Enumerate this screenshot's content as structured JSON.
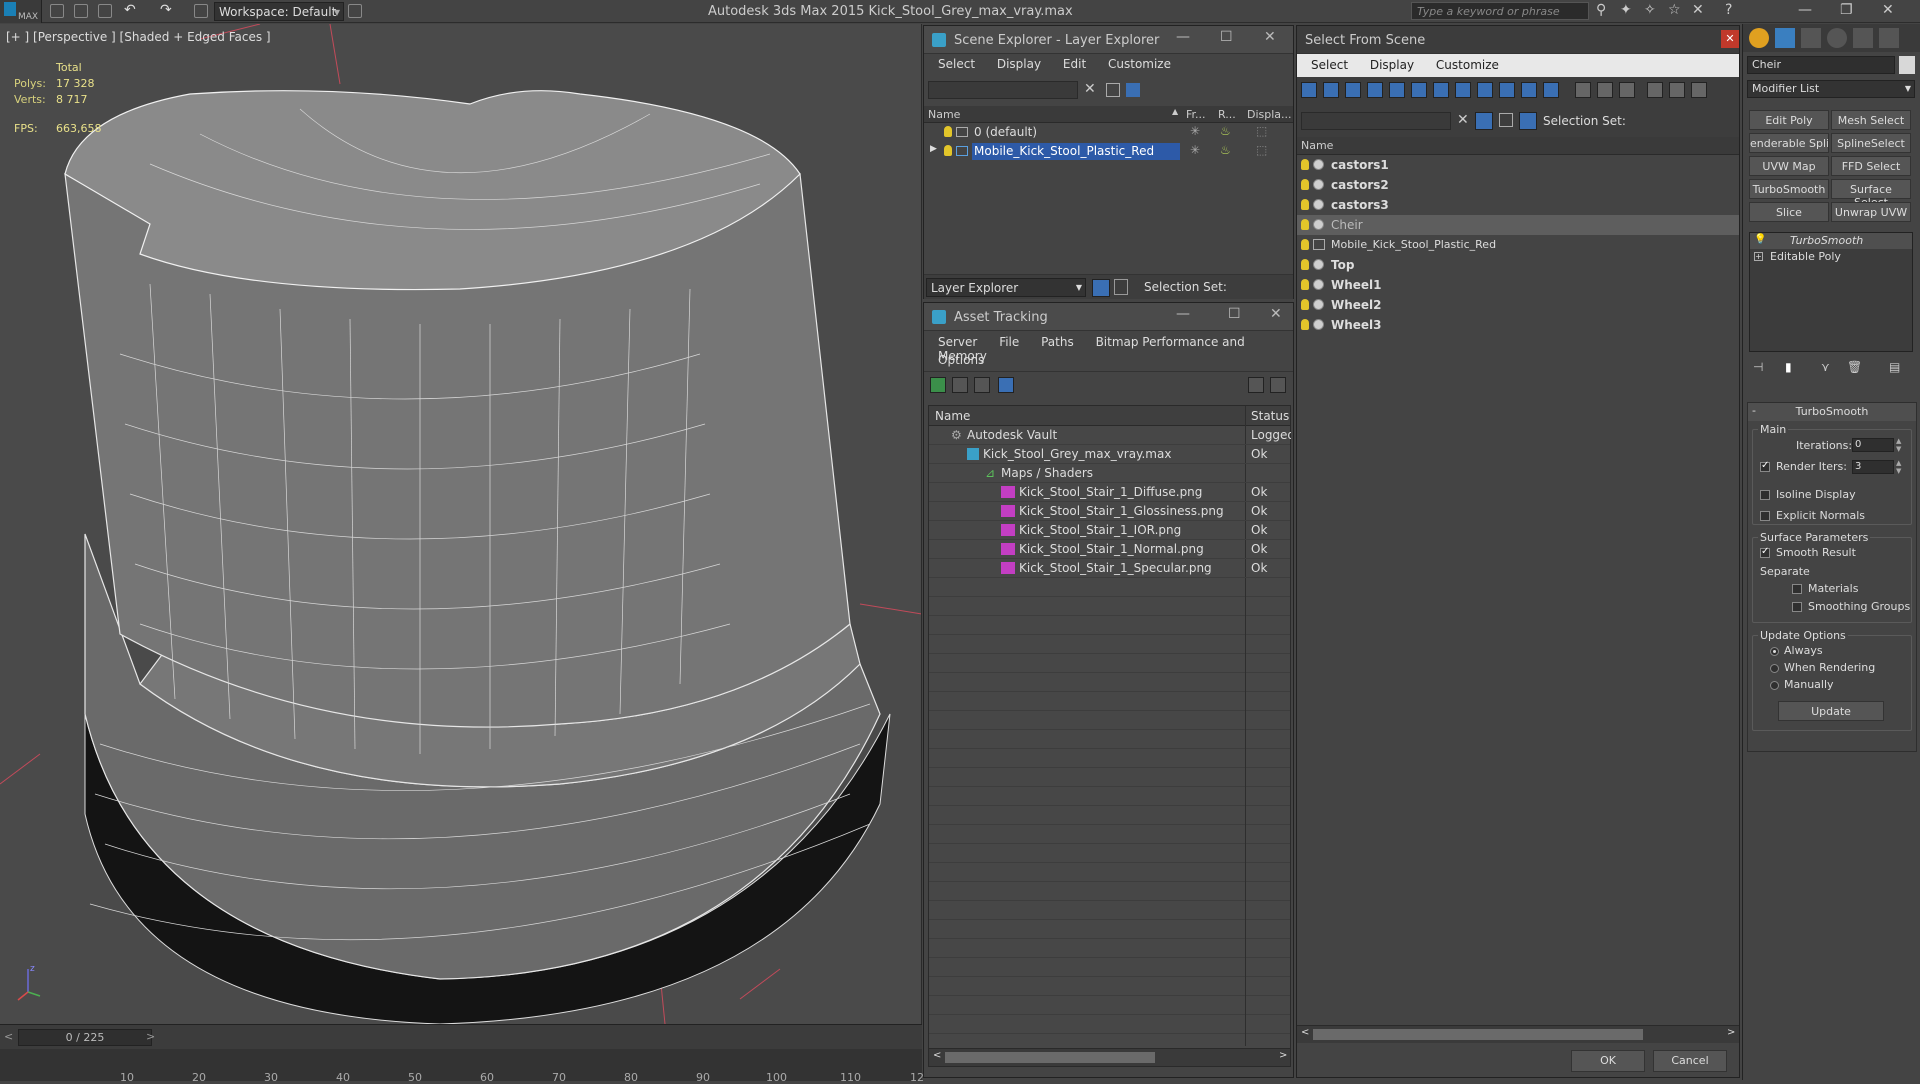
{
  "app": {
    "title": "Autodesk 3ds Max  2015      Kick_Stool_Grey_max_vray.max",
    "logo": "MAX",
    "workspace": "Workspace: Default",
    "search_placeholder": "Type a keyword or phrase"
  },
  "viewport": {
    "label": "[+ ] [Perspective ] [Shaded + Edged Faces ]",
    "stats": {
      "total_label": "Total",
      "polys_label": "Polys:",
      "polys_value": "17 328",
      "verts_label": "Verts:",
      "verts_value": "8 717",
      "fps_label": "FPS:",
      "fps_value": "663,658"
    },
    "axis_label": "z"
  },
  "timeline": {
    "frame": "0 / 225",
    "ticks": [
      "10",
      "20",
      "30",
      "40",
      "50",
      "60",
      "70",
      "80",
      "90",
      "100",
      "110",
      "12"
    ]
  },
  "scene_explorer": {
    "title": "Scene Explorer - Layer Explorer",
    "menu": [
      "Select",
      "Display",
      "Edit",
      "Customize"
    ],
    "columns": [
      "Name",
      "Fr...",
      "R...",
      "Displa..."
    ],
    "rows": [
      {
        "name": "0 (default)"
      },
      {
        "name": "Mobile_Kick_Stool_Plastic_Red"
      }
    ],
    "footer_dropdown": "Layer Explorer",
    "selection_set": "Selection Set:"
  },
  "asset_tracking": {
    "title": "Asset Tracking",
    "menu": [
      "Server",
      "File",
      "Paths",
      "Bitmap Performance and Memory"
    ],
    "menu2": "Options",
    "columns": [
      "Name",
      "Status"
    ],
    "rows": [
      {
        "name": "Autodesk Vault",
        "status": "Logged"
      },
      {
        "name": "Kick_Stool_Grey_max_vray.max",
        "status": "Ok"
      },
      {
        "name": "Maps / Shaders",
        "status": ""
      },
      {
        "name": "Kick_Stool_Stair_1_Diffuse.png",
        "status": "Ok"
      },
      {
        "name": "Kick_Stool_Stair_1_Glossiness.png",
        "status": "Ok"
      },
      {
        "name": "Kick_Stool_Stair_1_IOR.png",
        "status": "Ok"
      },
      {
        "name": "Kick_Stool_Stair_1_Normal.png",
        "status": "Ok"
      },
      {
        "name": "Kick_Stool_Stair_1_Specular.png",
        "status": "Ok"
      }
    ]
  },
  "select_from_scene": {
    "title": "Select From Scene",
    "menu": [
      "Select",
      "Display",
      "Customize"
    ],
    "selection_set": "Selection Set:",
    "column": "Name",
    "items": [
      "castors1",
      "castors2",
      "castors3",
      "Cheir",
      "Mobile_Kick_Stool_Plastic_Red",
      "Top",
      "Wheel1",
      "Wheel2",
      "Wheel3"
    ],
    "ok": "OK",
    "cancel": "Cancel"
  },
  "command_panel": {
    "object_name": "Cheir",
    "modifier_list": "Modifier List",
    "buttons": [
      "Edit Poly",
      "Mesh Select",
      "enderable Splir",
      "SplineSelect",
      "UVW Map",
      "FFD Select",
      "TurboSmooth",
      "Surface Select",
      "Slice",
      "Unwrap UVW"
    ],
    "stack": [
      "TurboSmooth",
      "Editable Poly"
    ],
    "rollout_title": "TurboSmooth",
    "main_label": "Main",
    "iterations_label": "Iterations:",
    "iterations_value": "0",
    "render_iters_label": "Render Iters:",
    "render_iters_value": "3",
    "isoline": "Isoline Display",
    "explicit_normals": "Explicit Normals",
    "surface_params": "Surface Parameters",
    "smooth_result": "Smooth Result",
    "separate": "Separate",
    "materials": "Materials",
    "smoothing_groups": "Smoothing Groups",
    "update_options": "Update Options",
    "always": "Always",
    "when_rendering": "When Rendering",
    "manually": "Manually",
    "update": "Update"
  }
}
